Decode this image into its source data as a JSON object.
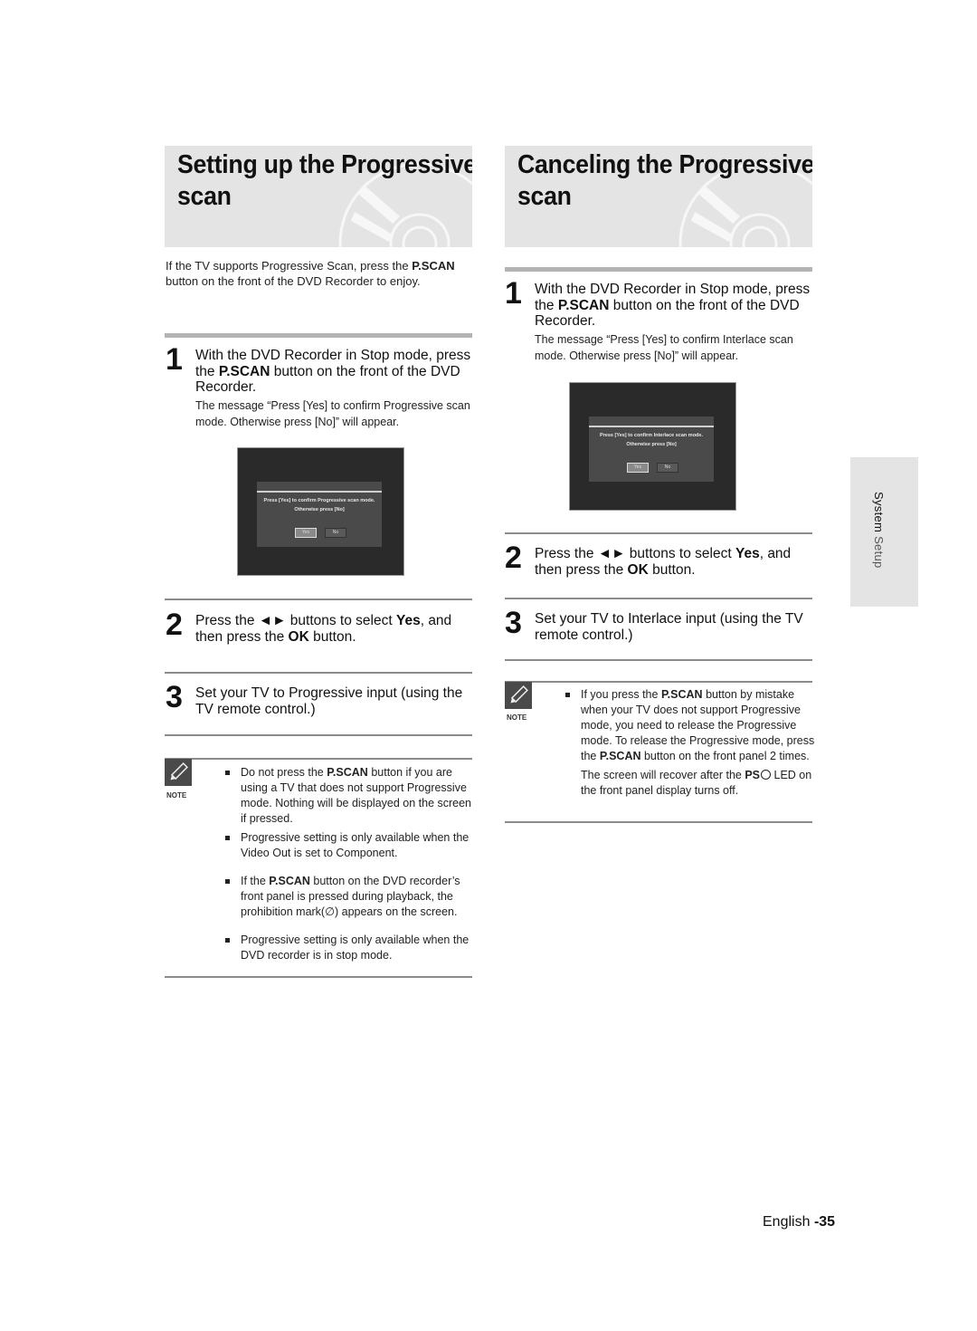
{
  "left": {
    "title_line1": "Setting up the Progressive",
    "title_line2": "scan",
    "intro": {
      "pre": "If the TV supports Progressive Scan, press the",
      "bold": "P.SCAN",
      "post": "button on the front of the DVD Recorder to enjoy."
    },
    "step1": {
      "num": "1",
      "a": "With the DVD Recorder in Stop mode, press the",
      "bold": "P.SCAN",
      "b": "button on the front of the DVD Recorder.",
      "sub": "The message “Press [Yes] to confirm Progressive scan mode. Otherwise press [No]” will appear."
    },
    "screen": {
      "line1": "Press [Yes] to confirm Progressive scan mode.",
      "line2": "Otherwise press [No]",
      "yes": "Yes",
      "no": "No"
    },
    "step2": {
      "num": "2",
      "a": "Press the ◄► buttons to select",
      "bold1": "Yes",
      "b": ", and then press the",
      "bold2": "OK",
      "c": "button."
    },
    "step3": {
      "num": "3",
      "text": "Set your TV to Progressive input (using the TV remote control.)"
    },
    "note_label": "NOTE",
    "notes": [
      {
        "pre": "Do not press the",
        "bold": "P.SCAN",
        "post": "button if you are using a TV that does not support Progressive mode. Nothing will be displayed on the screen if pressed."
      },
      {
        "pre": "Progressive setting is only available when the Video Out is set to Component.",
        "bold": "",
        "post": ""
      },
      {
        "pre": "If the",
        "bold": "P.SCAN",
        "post": "button on the DVD recorder’s front panel is pressed during playback, the prohibition mark(∅) appears on the screen."
      },
      {
        "pre": "Progressive setting is only available when the DVD recorder is in stop mode.",
        "bold": "",
        "post": ""
      }
    ]
  },
  "right": {
    "title_line1": "Canceling the Progressive",
    "title_line2": "scan",
    "step1": {
      "num": "1",
      "a": "With the DVD Recorder in Stop mode, press the",
      "bold": "P.SCAN",
      "b": "button on the front of the DVD Recorder.",
      "sub": "The message “Press [Yes] to confirm Interlace scan mode. Otherwise press [No]” will appear."
    },
    "screen": {
      "line1": "Press [Yes] to confirm Interlace scan mode.",
      "line2": "Otherwise press [No]",
      "yes": "Yes",
      "no": "No"
    },
    "step2": {
      "num": "2",
      "a": "Press the ◄► buttons to select",
      "bold1": "Yes",
      "b": ", and then press the",
      "bold2": "OK",
      "c": "button."
    },
    "step3": {
      "num": "3",
      "text": "Set your TV to Interlace input (using the TV remote control.)"
    },
    "note_label": "NOTE",
    "note": {
      "pre": "If you press the",
      "bold1": "P.SCAN",
      "mid": "button by mistake when your TV does not support Progressive mode, you need to release the Progressive mode. To release the Progressive mode, press the",
      "bold2": "P.SCAN",
      "post": "button on the front panel 2 times."
    },
    "note_cont": {
      "pre": "The screen will recover after the",
      "bold": "PS",
      "post": "LED on the front panel display turns off."
    }
  },
  "side_tab": {
    "word1": "System",
    "word2": "Setup"
  },
  "footer": {
    "lang": "English",
    "page": "-35"
  }
}
